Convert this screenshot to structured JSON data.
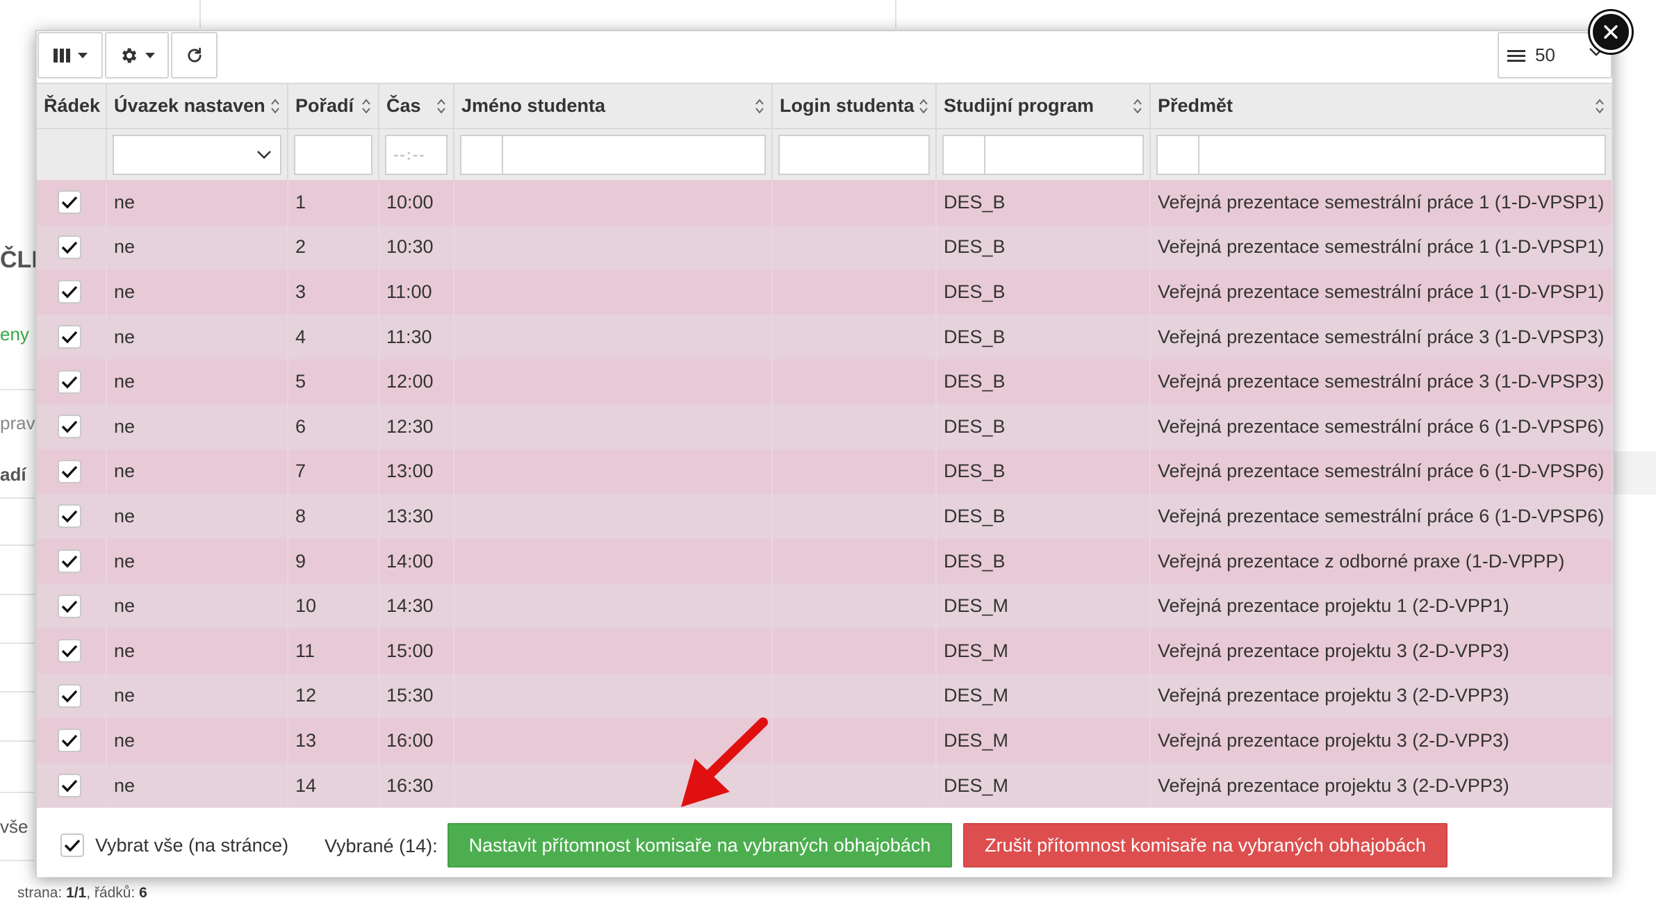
{
  "background": {
    "heading_fragment": "ČLE",
    "link_fragment": "eny",
    "input_fragment": "prav",
    "col_fragment": "adí",
    "select_all_fragment": "vše",
    "footer": {
      "page_label": "strana:",
      "page_value": "1/1",
      "rows_label": "řádků:",
      "rows_value": "6"
    }
  },
  "toolbar": {
    "page_size": "50"
  },
  "table": {
    "columns": [
      "Řádek",
      "Úvazek nastaven",
      "Pořadí",
      "Čas",
      "Jméno studenta",
      "Login studenta",
      "Studijní program",
      "Předmět"
    ],
    "time_placeholder": "--:--",
    "rows": [
      {
        "checked": true,
        "uvazek": "ne",
        "poradi": "1",
        "cas": "10:00",
        "jmeno": "",
        "login": "",
        "program": "DES_B",
        "predmet": "Veřejná prezentace semestrální práce 1 (1-D-VPSP1)"
      },
      {
        "checked": true,
        "uvazek": "ne",
        "poradi": "2",
        "cas": "10:30",
        "jmeno": "",
        "login": "",
        "program": "DES_B",
        "predmet": "Veřejná prezentace semestrální práce 1 (1-D-VPSP1)"
      },
      {
        "checked": true,
        "uvazek": "ne",
        "poradi": "3",
        "cas": "11:00",
        "jmeno": "",
        "login": "",
        "program": "DES_B",
        "predmet": "Veřejná prezentace semestrální práce 1 (1-D-VPSP1)"
      },
      {
        "checked": true,
        "uvazek": "ne",
        "poradi": "4",
        "cas": "11:30",
        "jmeno": "",
        "login": "",
        "program": "DES_B",
        "predmet": "Veřejná prezentace semestrální práce 3 (1-D-VPSP3)"
      },
      {
        "checked": true,
        "uvazek": "ne",
        "poradi": "5",
        "cas": "12:00",
        "jmeno": "",
        "login": "",
        "program": "DES_B",
        "predmet": "Veřejná prezentace semestrální práce 3 (1-D-VPSP3)"
      },
      {
        "checked": true,
        "uvazek": "ne",
        "poradi": "6",
        "cas": "12:30",
        "jmeno": "",
        "login": "",
        "program": "DES_B",
        "predmet": "Veřejná prezentace semestrální práce 6 (1-D-VPSP6)"
      },
      {
        "checked": true,
        "uvazek": "ne",
        "poradi": "7",
        "cas": "13:00",
        "jmeno": "",
        "login": "",
        "program": "DES_B",
        "predmet": "Veřejná prezentace semestrální práce 6 (1-D-VPSP6)"
      },
      {
        "checked": true,
        "uvazek": "ne",
        "poradi": "8",
        "cas": "13:30",
        "jmeno": "",
        "login": "",
        "program": "DES_B",
        "predmet": "Veřejná prezentace semestrální práce 6 (1-D-VPSP6)"
      },
      {
        "checked": true,
        "uvazek": "ne",
        "poradi": "9",
        "cas": "14:00",
        "jmeno": "",
        "login": "",
        "program": "DES_B",
        "predmet": "Veřejná prezentace z odborné praxe (1-D-VPPP)"
      },
      {
        "checked": true,
        "uvazek": "ne",
        "poradi": "10",
        "cas": "14:30",
        "jmeno": "",
        "login": "",
        "program": "DES_M",
        "predmet": "Veřejná prezentace projektu 1 (2-D-VPP1)"
      },
      {
        "checked": true,
        "uvazek": "ne",
        "poradi": "11",
        "cas": "15:00",
        "jmeno": "",
        "login": "",
        "program": "DES_M",
        "predmet": "Veřejná prezentace projektu 3 (2-D-VPP3)"
      },
      {
        "checked": true,
        "uvazek": "ne",
        "poradi": "12",
        "cas": "15:30",
        "jmeno": "",
        "login": "",
        "program": "DES_M",
        "predmet": "Veřejná prezentace projektu 3 (2-D-VPP3)"
      },
      {
        "checked": true,
        "uvazek": "ne",
        "poradi": "13",
        "cas": "16:00",
        "jmeno": "",
        "login": "",
        "program": "DES_M",
        "predmet": "Veřejná prezentace projektu 3 (2-D-VPP3)"
      },
      {
        "checked": true,
        "uvazek": "ne",
        "poradi": "14",
        "cas": "16:30",
        "jmeno": "",
        "login": "",
        "program": "DES_M",
        "predmet": "Veřejná prezentace projektu 3 (2-D-VPP3)"
      }
    ]
  },
  "footer": {
    "select_all_label": "Vybrat vše (na stránce)",
    "selected_label": "Vybrané (14):",
    "set_button": "Nastavit přítomnost komisaře na vybraných obhajobách",
    "cancel_button": "Zrušit přítomnost komisaře na vybraných obhajobách"
  },
  "colors": {
    "row_odd": "#e8cad6",
    "row_even": "#e6d2db",
    "green": "#4cae4f",
    "red": "#dd4e4e",
    "arrow": "#e01010"
  },
  "icons": [
    "columns-icon",
    "gear-icon",
    "refresh-icon",
    "list-icon",
    "close-icon",
    "sort-icon",
    "checkmark-icon",
    "chevron-down-icon",
    "arrow-annotation"
  ]
}
